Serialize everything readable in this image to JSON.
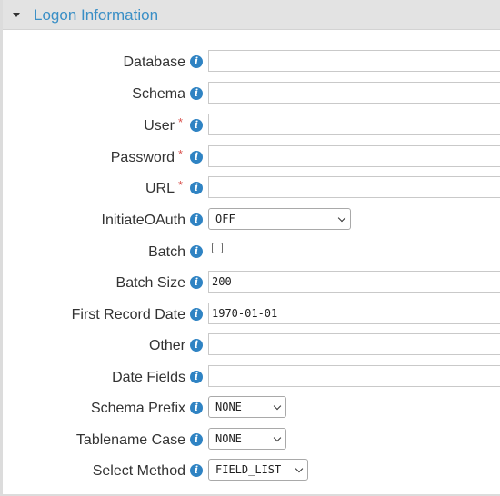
{
  "section": {
    "title": "Logon Information"
  },
  "fields": {
    "database": {
      "label": "Database",
      "value": ""
    },
    "schema": {
      "label": "Schema",
      "value": ""
    },
    "user": {
      "label": "User",
      "required_mark": "*",
      "value": ""
    },
    "password": {
      "label": "Password",
      "required_mark": "*",
      "value": ""
    },
    "url": {
      "label": "URL",
      "required_mark": "*",
      "value": ""
    },
    "initiate_oauth": {
      "label": "InitiateOAuth",
      "selected": "OFF"
    },
    "batch": {
      "label": "Batch",
      "checked": false
    },
    "batch_size": {
      "label": "Batch Size",
      "value": "200"
    },
    "first_record_date": {
      "label": "First Record Date",
      "value": "1970-01-01"
    },
    "other": {
      "label": "Other",
      "value": ""
    },
    "date_fields": {
      "label": "Date Fields",
      "value": ""
    },
    "schema_prefix": {
      "label": "Schema Prefix",
      "selected": "NONE"
    },
    "tablename_case": {
      "label": "Tablename Case",
      "selected": "NONE"
    },
    "select_method": {
      "label": "Select Method",
      "selected": "FIELD_LIST"
    }
  },
  "icons": {
    "info": "info-icon",
    "collapse": "caret-down-icon",
    "dropdown": "chevron-down-icon"
  },
  "colors": {
    "header_bg": "#e3e3e3",
    "title": "#3a8fc6",
    "info_icon": "#2f83c3",
    "required": "#d9534f"
  }
}
